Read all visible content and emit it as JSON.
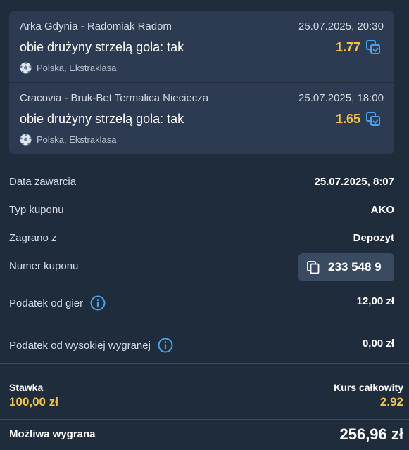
{
  "colors": {
    "background": "#1f2c3c",
    "card": "#2c3b51",
    "accent": "#f6c347",
    "icon": "#4aa3e8"
  },
  "events": [
    {
      "teams": "Arka Gdynia - Radomiak Radom",
      "datetime": "25.07.2025, 20:30",
      "market": "obie drużyny strzelą gola: tak",
      "odd": "1.77",
      "league": "Polska, Ekstraklasa",
      "icons": [
        "football-icon",
        "copy-selection-icon"
      ]
    },
    {
      "teams": "Cracovia - Bruk-Bet Termalica Nieciecza",
      "datetime": "25.07.2025, 18:00",
      "market": "obie drużyny strzelą gola: tak",
      "odd": "1.65",
      "league": "Polska, Ekstraklasa",
      "icons": [
        "football-icon",
        "copy-selection-icon"
      ]
    }
  ],
  "details": {
    "date_label": "Data zawarcia",
    "date_value": "25.07.2025, 8:07",
    "type_label": "Typ kuponu",
    "type_value": "AKO",
    "source_label": "Zagrano z",
    "source_value": "Depozyt",
    "number_label": "Numer kuponu",
    "number_value": "233 548 9",
    "tax_label": "Podatek od gier",
    "tax_value": "12,00 zł",
    "hightax_label": "Podatek od wysokiej wygranej",
    "hightax_value": "0,00 zł"
  },
  "summary": {
    "stake_label": "Stawka",
    "stake_value": "100,00 zł",
    "total_odds_label": "Kurs całkowity",
    "total_odds_value": "2.92",
    "win_label": "Możliwa wygrana",
    "win_value": "256,96 zł"
  }
}
